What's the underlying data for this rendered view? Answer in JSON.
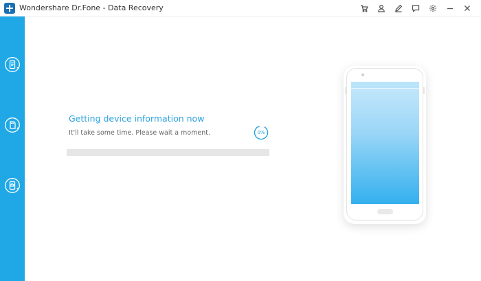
{
  "window": {
    "title": "Wondershare Dr.Fone - Data Recovery"
  },
  "toolbar": {
    "icons": [
      "cart-icon",
      "user-icon",
      "edit-icon",
      "feedback-icon",
      "settings-icon",
      "minimize-icon",
      "close-icon"
    ]
  },
  "sidebar": {
    "items": [
      {
        "icon": "phone-recovery-icon",
        "active": true
      },
      {
        "icon": "sd-card-recovery-icon",
        "active": false
      },
      {
        "icon": "icloud-backup-recovery-icon",
        "active": false
      }
    ]
  },
  "status": {
    "title": "Getting device information now",
    "subtitle": "It'll take some time. Please wait a moment.",
    "percent_label": "0%",
    "progress": 0
  },
  "colors": {
    "accent": "#2aa3e0",
    "sidebar": "#20a8e6"
  }
}
